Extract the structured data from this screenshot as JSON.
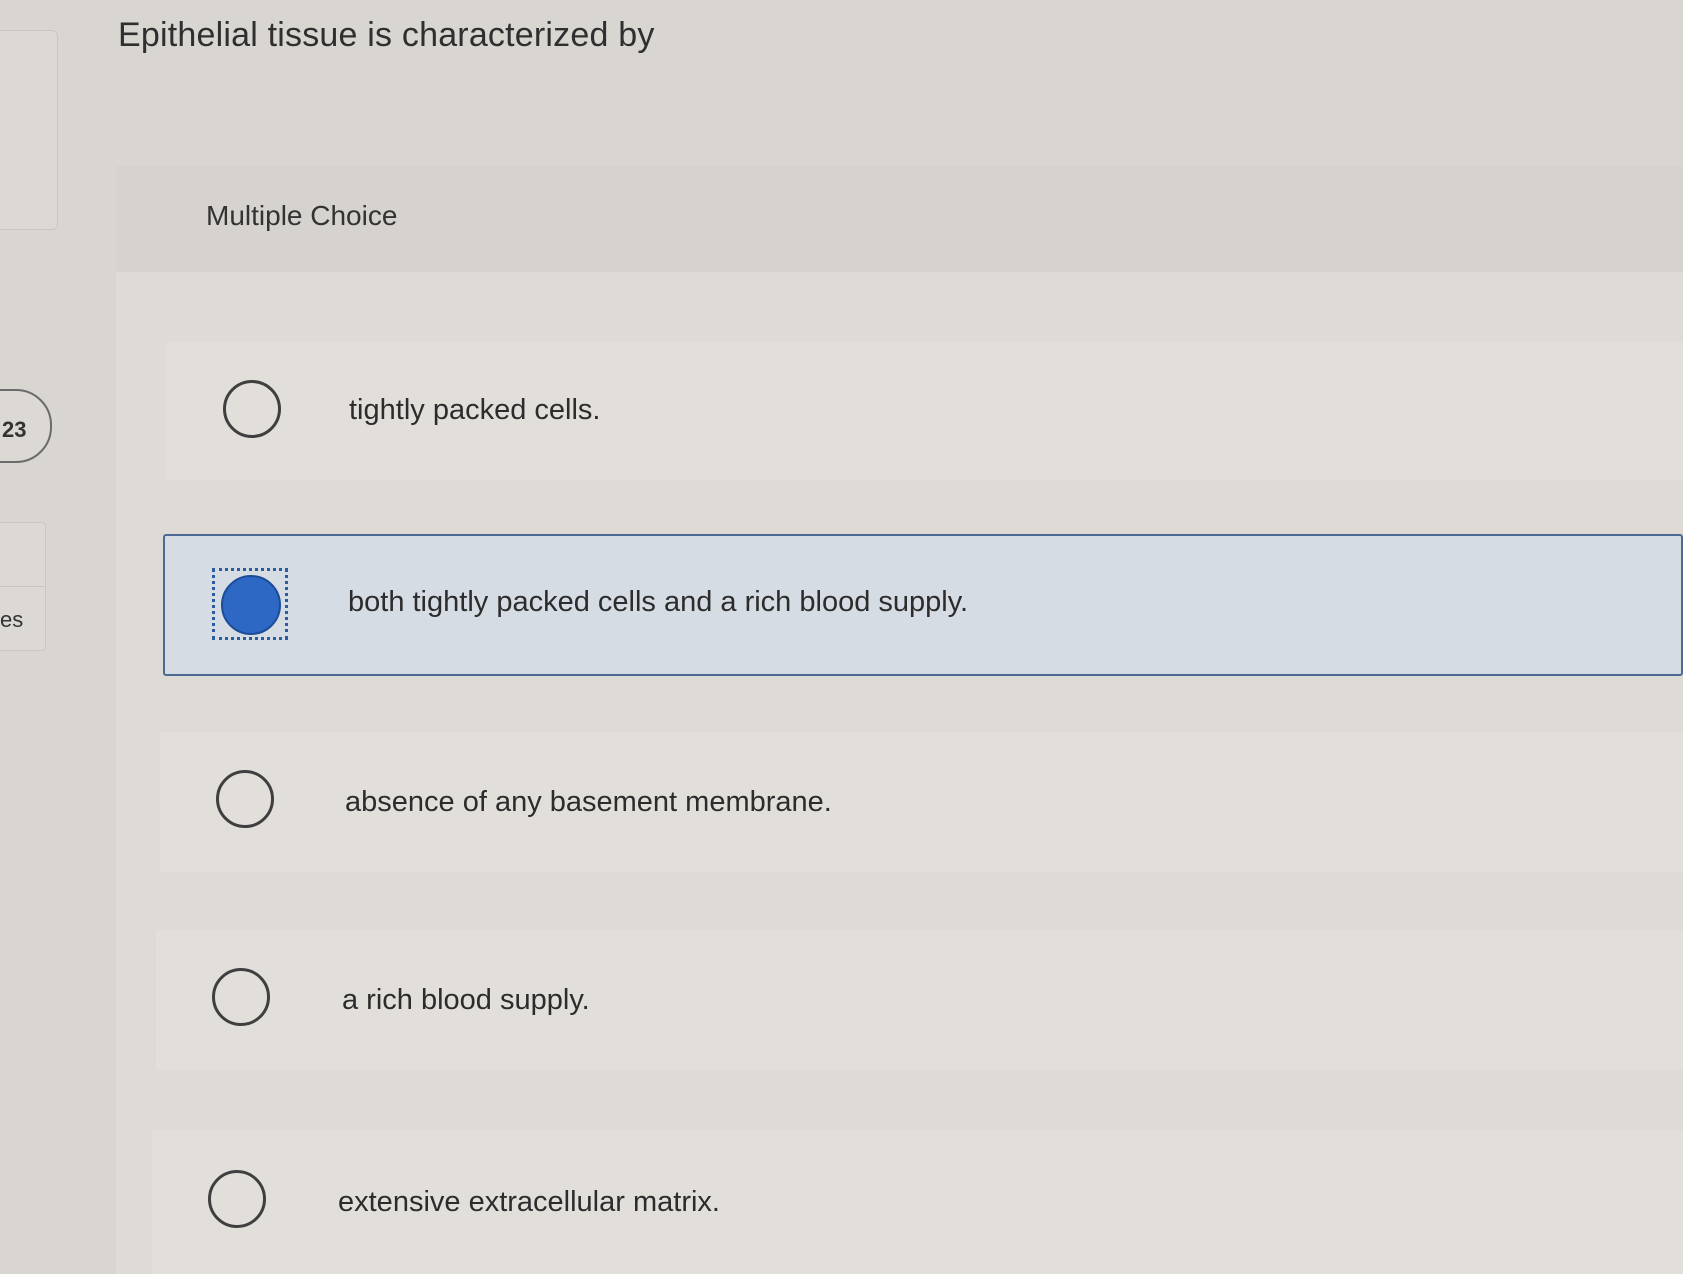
{
  "left_rail": {
    "question_number_partial": "23",
    "bottom_card_partial_text": "es"
  },
  "question": {
    "title": "Epithelial tissue is characterized by",
    "type_label": "Multiple Choice",
    "options": [
      {
        "label": "tightly packed cells.",
        "selected": false
      },
      {
        "label": "both tightly packed cells and a rich blood supply.",
        "selected": true
      },
      {
        "label": "absence of any basement membrane.",
        "selected": false
      },
      {
        "label": "a rich blood supply.",
        "selected": false
      },
      {
        "label": "extensive extracellular matrix.",
        "selected": false
      }
    ]
  },
  "colors": {
    "selected_accent": "#2d68c4",
    "selected_border": "#4c6a92"
  }
}
